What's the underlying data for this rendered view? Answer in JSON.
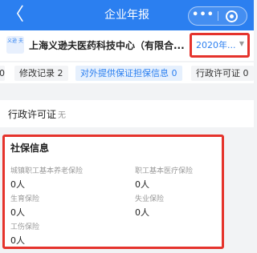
{
  "nav": {
    "title": "企业年报",
    "back_glyph": "〈",
    "more_glyph": "•••"
  },
  "company": {
    "logo_text": "义逊 夫",
    "name": "上海义逊夫医药科技中心（有限合...",
    "year": "2020年...",
    "year_caret": "▼"
  },
  "tabs": [
    {
      "label": "0"
    },
    {
      "label": "修改记录 2"
    },
    {
      "label": "对外提供保证担保信息 0"
    },
    {
      "label": "行政许可证 0"
    }
  ],
  "license": {
    "title": "行政许可证",
    "empty": "无"
  },
  "social": {
    "title": "社保信息",
    "items": [
      {
        "label": "城镇职工基本养老保险",
        "value": "0人"
      },
      {
        "label": "职工基本医疗保险",
        "value": "0人"
      },
      {
        "label": "生育保险",
        "value": "0人"
      },
      {
        "label": "失业保险",
        "value": "0人"
      },
      {
        "label": "工伤保险",
        "value": "0人"
      }
    ]
  },
  "colors": {
    "brand_blue": "#2b7ff0",
    "highlight_red": "#e5332c",
    "page_bg": "#f2f3f5"
  }
}
